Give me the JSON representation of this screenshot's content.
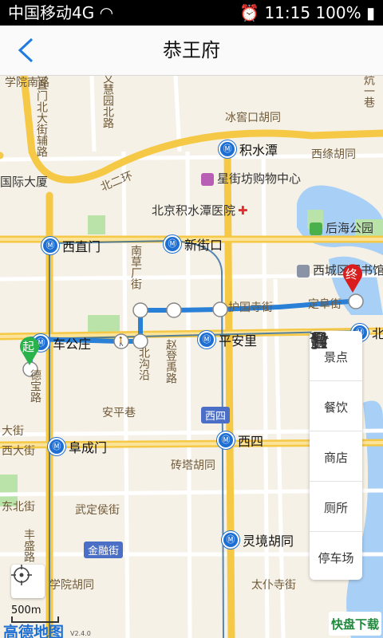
{
  "status_bar": {
    "carrier": "中国移动4G",
    "time": "11:15",
    "battery": "100%"
  },
  "header": {
    "title": "恭王府"
  },
  "map": {
    "road_labels": [
      "学院南路",
      "文慧园北路",
      "西直门北大街辅路",
      "冰窖口胡同",
      "六铺炕一巷",
      "北二环",
      "南草厂街",
      "赵登禹路",
      "北沟沿",
      "西绦胡同",
      "定阜街",
      "护国寺街",
      "西大街",
      "东北街",
      "丰盛路",
      "大街",
      "武定侯街",
      "金融街",
      "砖塔胡同",
      "学院胡同",
      "太仆寺街",
      "安平巷",
      "德宝路"
    ],
    "poi_labels": [
      "积水潭",
      "星街坊购物中心",
      "北京积水潭医院",
      "后海公园",
      "西城区图书馆",
      "国际大厦"
    ],
    "stations": [
      "积水潭",
      "西直门",
      "新街口",
      "车公庄",
      "平安里",
      "阜成门",
      "西四",
      "灵境胡同",
      "北海"
    ],
    "route": {
      "start_marker": "起",
      "end_marker": "终"
    },
    "district_badge": "西四"
  },
  "side_panel": {
    "items": [
      {
        "label": "景点",
        "icon": "landmark-icon"
      },
      {
        "label": "餐饮",
        "icon": "fork-knife-icon"
      },
      {
        "label": "商店",
        "icon": "cart-icon"
      },
      {
        "label": "厕所",
        "icon": "restroom-icon"
      },
      {
        "label": "停车场",
        "icon": "parking-icon"
      }
    ]
  },
  "map_controls": {
    "scale": "500m",
    "logo": "高德地图",
    "version": "V2.4.0",
    "watermark": "快盘下载"
  },
  "colors": {
    "route_blue": "#2a7fd6",
    "road_yellow": "#f7cf57",
    "water_blue": "#a8cff5",
    "park_green": "#b9e3a8",
    "start_green": "#2ab34a",
    "end_red": "#d91c1c"
  }
}
